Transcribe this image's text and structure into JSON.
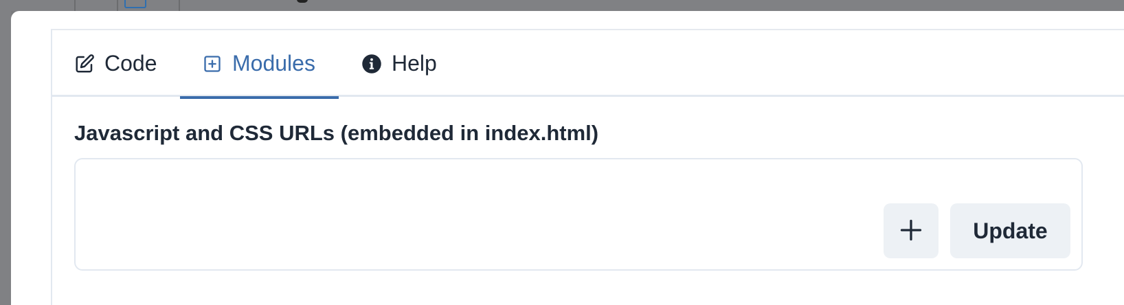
{
  "tabs": [
    {
      "label": "Code",
      "icon": "pencil-square-icon",
      "active": false
    },
    {
      "label": "Modules",
      "icon": "plus-square-icon",
      "active": true
    },
    {
      "label": "Help",
      "icon": "info-circle-icon",
      "active": false
    }
  ],
  "modules": {
    "section_title": "Javascript and CSS URLs (embedded in index.html)",
    "url_value": "",
    "add_button_icon": "plus-icon",
    "update_label": "Update"
  },
  "colors": {
    "accent": "#3a6cab",
    "text": "#1f2937",
    "button_bg": "#edf1f5",
    "border": "#e2e8f0",
    "overlay": "#7b7c7e"
  }
}
